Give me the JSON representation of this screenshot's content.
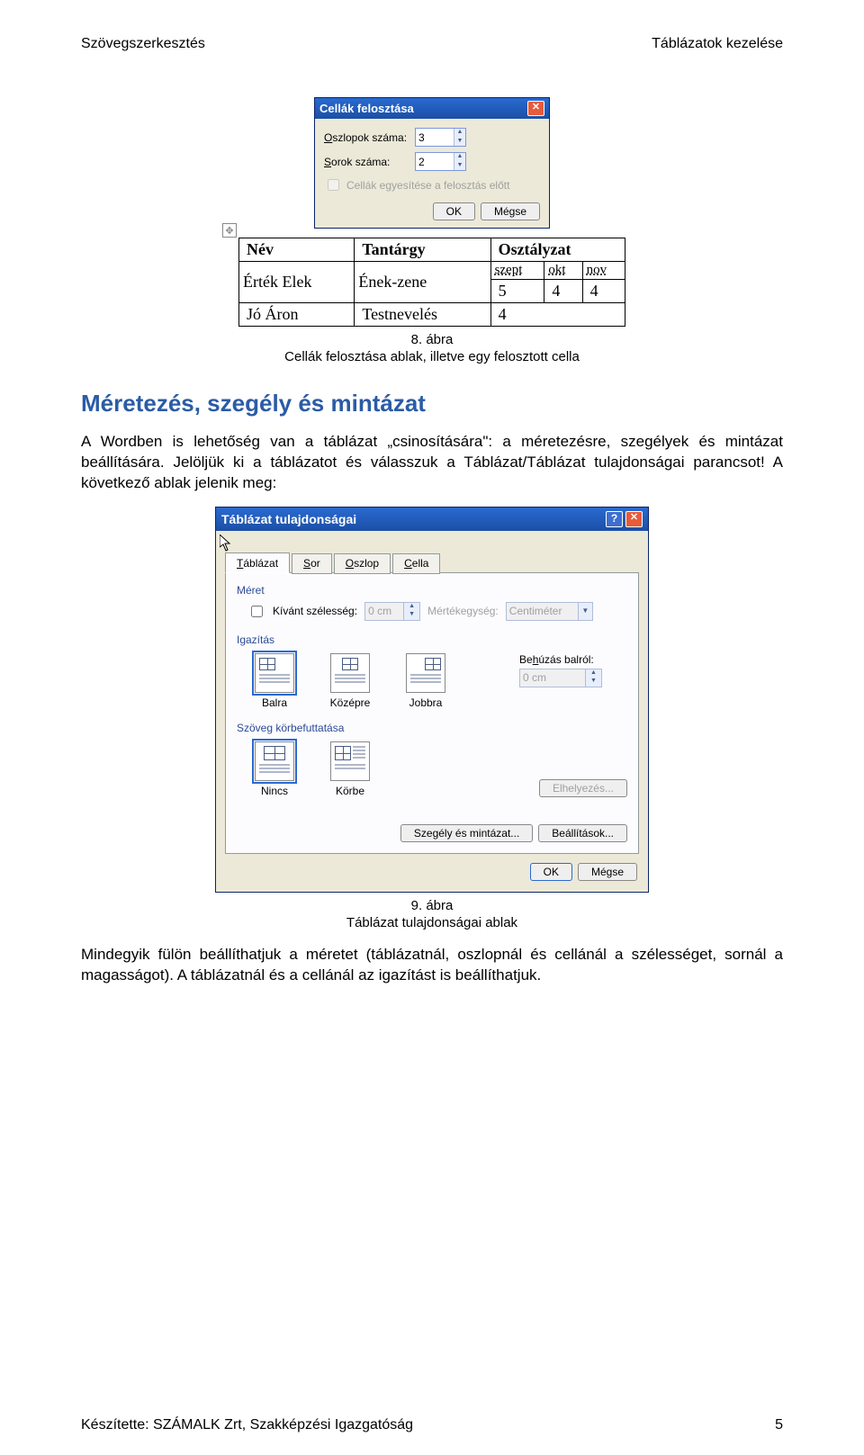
{
  "header": {
    "left": "Szövegszerkesztés",
    "right": "Táblázatok kezelése"
  },
  "dialog1": {
    "title": "Cellák felosztása",
    "col_label": "Oszlopok száma:",
    "row_label": "Sorok száma:",
    "cols": "3",
    "rows": "2",
    "merge_label": "Cellák egyesítése a felosztás előtt",
    "ok": "OK",
    "cancel": "Mégse"
  },
  "fig2": {
    "h1": "Név",
    "h2": "Tantárgy",
    "h3": "Osztályzat",
    "r1c1": "Érték Elek",
    "r1c2": "Ének-zene",
    "m1": "szept",
    "m2": "okt",
    "m3": "nov",
    "g1": "5",
    "g2": "4",
    "g3": "4",
    "r3c1": "Jó Áron",
    "r3c2": "Testnevelés",
    "r3c3": "4",
    "move": "✥"
  },
  "caption1a": "8. ábra",
  "caption1b": "Cellák felosztása ablak, illetve egy felosztott cella",
  "section_title": "Méretezés, szegély és mintázat",
  "para1": "A Wordben is lehetőség van a táblázat „csinosítására\": a méretezésre, szegélyek és mintázat beállítására. Jelöljük ki a táblázatot és válasszuk a Táblázat/Táblázat tulajdonságai parancsot! A következő ablak jelenik meg:",
  "dialog2": {
    "title": "Táblázat tulajdonságai",
    "tabs": {
      "t1": "Táblázat",
      "t2": "Sor",
      "t3": "Oszlop",
      "t4": "Cella",
      "t1u": "T",
      "t2u": "S",
      "t3u": "O",
      "t4u": "C"
    },
    "grp_size": "Méret",
    "pref_width": "Kívánt szélesség:",
    "pref_width_u": "K",
    "width_val": "0 cm",
    "unit_label": "Mértékegység:",
    "unit_u": "M",
    "unit_val": "Centiméter",
    "grp_align": "Igazítás",
    "indent_label": "Behúzás balról:",
    "indent_u": "h",
    "indent_val": "0 cm",
    "align": {
      "left": "Balra",
      "left_u": "B",
      "center": "Középre",
      "center_u": "K",
      "right": "Jobbra",
      "right_u": "J"
    },
    "grp_wrap": "Szöveg körbefuttatása",
    "wrap": {
      "none": "Nincs",
      "none_u": "N",
      "around": "Körbe",
      "around_u": "e"
    },
    "btn_place": "Elhelyezés...",
    "btn_border": "Szegély és mintázat...",
    "btn_border_u": "z",
    "btn_options": "Beállítások...",
    "btn_options_u": "l",
    "ok": "OK",
    "cancel": "Mégse"
  },
  "caption2a": "9. ábra",
  "caption2b": "Táblázat tulajdonságai ablak",
  "para2": "Mindegyik fülön beállíthatjuk a méretet (táblázatnál, oszlopnál és cellánál a szélességet, sornál a magasságot). A táblázatnál és a cellánál az igazítást is beállíthatjuk.",
  "footer": {
    "left": "Készítette: SZÁMALK Zrt, Szakképzési Igazgatóság",
    "right": "5"
  }
}
